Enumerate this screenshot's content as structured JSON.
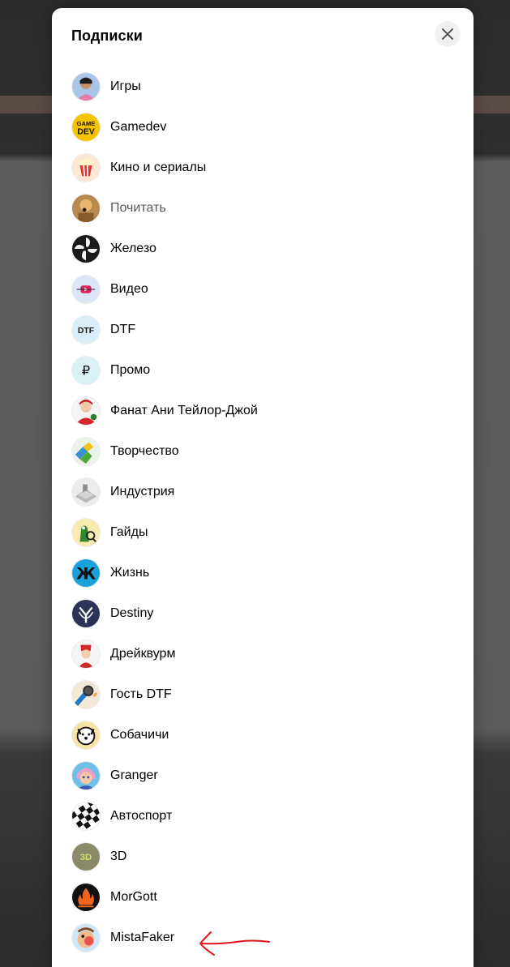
{
  "modal": {
    "title": "Подписки",
    "close_icon": "close-icon"
  },
  "subscriptions": [
    {
      "label": "Игры",
      "icon": "avatar-igry"
    },
    {
      "label": "Gamedev",
      "icon": "avatar-gamedev",
      "icon_text_top": "GAME",
      "icon_text_bottom": "DEV"
    },
    {
      "label": "Кино и сериалы",
      "icon": "popcorn-icon"
    },
    {
      "label": "Почитать",
      "icon": "avatar-pochitat",
      "muted": true
    },
    {
      "label": "Железо",
      "icon": "fan-icon"
    },
    {
      "label": "Видео",
      "icon": "video-icon"
    },
    {
      "label": "DTF",
      "icon": "dtf-icon",
      "icon_text": "DTF"
    },
    {
      "label": "Промо",
      "icon": "ruble-icon",
      "icon_text": "₽"
    },
    {
      "label": "Фанат Ани Тейлор-Джой",
      "icon": "avatar-fanat"
    },
    {
      "label": "Творчество",
      "icon": "avatar-tvorchestvo"
    },
    {
      "label": "Индустрия",
      "icon": "avatar-industriya"
    },
    {
      "label": "Гайды",
      "icon": "avatar-gaidy"
    },
    {
      "label": "Жизнь",
      "icon": "zh-icon",
      "icon_text": "Ж"
    },
    {
      "label": "Destiny",
      "icon": "destiny-icon"
    },
    {
      "label": "Дрейквурм",
      "icon": "avatar-dreikvurm"
    },
    {
      "label": "Гость DTF",
      "icon": "microphone-icon"
    },
    {
      "label": "Собачичи",
      "icon": "dog-icon"
    },
    {
      "label": "Granger",
      "icon": "avatar-granger"
    },
    {
      "label": "Автоспорт",
      "icon": "checkered-flag-icon"
    },
    {
      "label": "3D",
      "icon": "avatar-3d",
      "icon_text": "3D"
    },
    {
      "label": "MorGott",
      "icon": "fire-icon"
    },
    {
      "label": "MistaFaker",
      "icon": "avatar-mistafaker"
    }
  ],
  "colors": {
    "annotation_arrow": "#e0141a",
    "title": "#000000",
    "muted_label": "#5a5a5a"
  }
}
